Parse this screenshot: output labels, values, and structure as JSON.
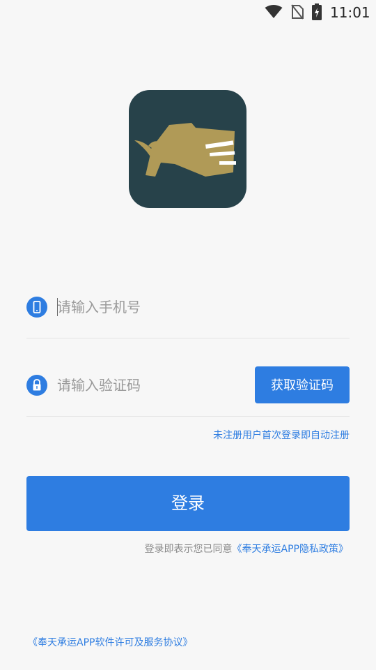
{
  "status_bar": {
    "time": "11:01",
    "icons": [
      "wifi-icon",
      "no-sim-icon",
      "battery-charging-icon"
    ]
  },
  "logo": {
    "icon": "rhino-logo-icon",
    "background_color": "#27424a",
    "mark_color": "#b09a57"
  },
  "form": {
    "phone": {
      "icon": "phone-icon",
      "placeholder": "请输入手机号",
      "value": ""
    },
    "code": {
      "icon": "lock-icon",
      "placeholder": "请输入验证码",
      "value": "",
      "get_code_label": "获取验证码"
    },
    "auto_register_note": "未注册用户首次登录即自动注册"
  },
  "login": {
    "label": "登录"
  },
  "agreement": {
    "prefix": "登录即表示您已同意",
    "privacy_link": "《奉天承运APP隐私政策》"
  },
  "footer": {
    "license_link": "《奉天承运APP软件许可及服务协议》"
  },
  "colors": {
    "accent": "#2e7de1",
    "background": "#f7f7f7"
  }
}
